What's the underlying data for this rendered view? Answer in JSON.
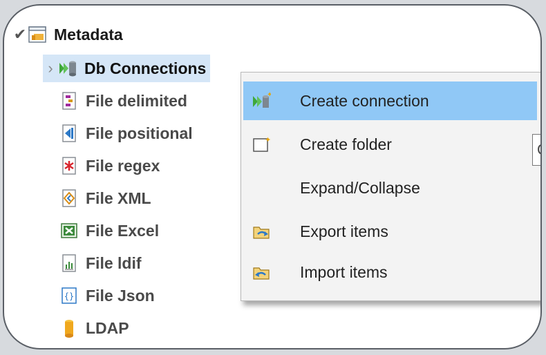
{
  "tree": {
    "root": {
      "label": "Metadata",
      "icon": "metadata-folder-icon"
    },
    "items": [
      {
        "label": "Db Connections",
        "icon": "db-connections-icon",
        "selected": true,
        "expander": "›"
      },
      {
        "label": "File delimited",
        "icon": "file-delimited-icon"
      },
      {
        "label": "File positional",
        "icon": "file-positional-icon"
      },
      {
        "label": "File regex",
        "icon": "file-regex-icon"
      },
      {
        "label": "File XML",
        "icon": "file-xml-icon"
      },
      {
        "label": "File Excel",
        "icon": "file-excel-icon"
      },
      {
        "label": "File ldif",
        "icon": "file-ldif-icon"
      },
      {
        "label": "File Json",
        "icon": "file-json-icon"
      },
      {
        "label": "LDAP",
        "icon": "ldap-icon"
      }
    ]
  },
  "context_menu": {
    "items": [
      {
        "label": "Create connection",
        "icon": "create-connection-icon",
        "highlighted": true
      },
      {
        "label": "Create folder",
        "icon": "create-folder-icon"
      },
      {
        "label": "Expand/Collapse",
        "icon": ""
      },
      {
        "label": "Export items",
        "icon": "export-items-icon"
      },
      {
        "label": "Import items",
        "icon": "import-items-icon"
      }
    ]
  },
  "tooltip": {
    "text": "C"
  },
  "colors": {
    "selection": "#d5e6f7",
    "menu_highlight": "#90c8f6",
    "menu_bg": "#f3f3f3"
  }
}
